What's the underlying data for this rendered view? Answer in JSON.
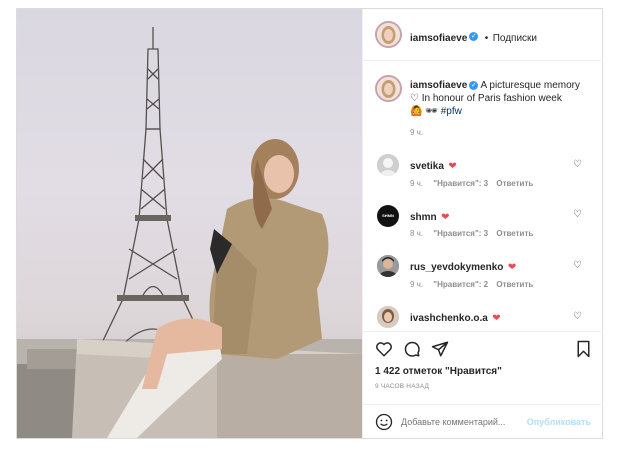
{
  "header": {
    "username": "iamsofiaeve",
    "separator": "•",
    "follow_label": "Подписки"
  },
  "caption": {
    "username": "iamsofiaeve",
    "line1": "A picturesque memory",
    "line2": "In honour of Paris fashion week",
    "hashtag": "#pfw",
    "time": "9 ч."
  },
  "comments": [
    {
      "username": "svetika",
      "time": "9 ч.",
      "likes": "\"Нравится\": 3",
      "reply": "Ответить",
      "avatar_label": ""
    },
    {
      "username": "shmn",
      "time": "8 ч.",
      "likes": "\"Нравится\": 3",
      "reply": "Ответить",
      "avatar_label": "SHMN"
    },
    {
      "username": "rus_yevdokymenko",
      "time": "9 ч.",
      "likes": "\"Нравится\": 2",
      "reply": "Ответить",
      "avatar_label": ""
    },
    {
      "username": "ivashchenko.o.a",
      "time": "",
      "likes": "",
      "reply": "",
      "avatar_label": ""
    }
  ],
  "stats": {
    "likes": "1 422 отметок \"Нравится\"",
    "time_ago": "9 ЧАСОВ НАЗАД"
  },
  "composer": {
    "placeholder": "Добавьте комментарий...",
    "publish_label": "Опубликовать"
  },
  "icons": {
    "like": "heart-outline-icon",
    "comment": "comment-bubble-icon",
    "share": "paper-plane-icon",
    "save": "bookmark-icon",
    "emoji": "emoji-smile-icon",
    "verified": "verified-badge-icon"
  },
  "colors": {
    "heart_red": "#ed4956",
    "verified_blue": "#3897f0",
    "publish_disabled": "#b2dffc"
  }
}
